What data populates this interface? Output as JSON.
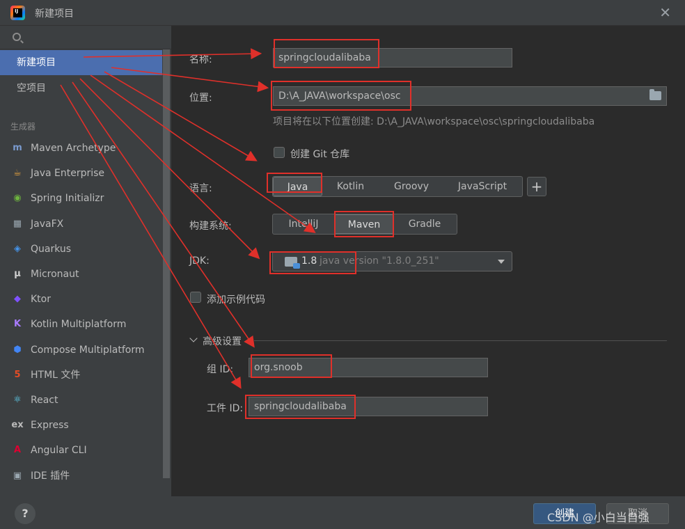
{
  "window": {
    "title": "新建项目",
    "logo_text": "IJ"
  },
  "sidebar": {
    "items": [
      {
        "label": "新建项目"
      },
      {
        "label": "空项目"
      }
    ],
    "section_title": "生成器",
    "generators": [
      {
        "label": "Maven Archetype",
        "icon": "maven-icon",
        "glyph": "m",
        "color": "#7a9bcf"
      },
      {
        "label": "Java Enterprise",
        "icon": "java-enterprise-icon",
        "glyph": "☕",
        "color": "#e7a33e"
      },
      {
        "label": "Spring Initializr",
        "icon": "spring-icon",
        "glyph": "◉",
        "color": "#6db33f"
      },
      {
        "label": "JavaFX",
        "icon": "javafx-icon",
        "glyph": "▦",
        "color": "#9aa7b0"
      },
      {
        "label": "Quarkus",
        "icon": "quarkus-icon",
        "glyph": "◈",
        "color": "#4695eb"
      },
      {
        "label": "Micronaut",
        "icon": "micronaut-icon",
        "glyph": "μ",
        "color": "#cfcfcf"
      },
      {
        "label": "Ktor",
        "icon": "ktor-icon",
        "glyph": "◆",
        "color": "#7f52ff"
      },
      {
        "label": "Kotlin Multiplatform",
        "icon": "kotlin-icon",
        "glyph": "K",
        "color": "#a97bff"
      },
      {
        "label": "Compose Multiplatform",
        "icon": "compose-icon",
        "glyph": "⬢",
        "color": "#4285f4"
      },
      {
        "label": "HTML 文件",
        "icon": "html5-icon",
        "glyph": "5",
        "color": "#e44d26"
      },
      {
        "label": "React",
        "icon": "react-icon",
        "glyph": "⚛",
        "color": "#61dafb"
      },
      {
        "label": "Express",
        "icon": "express-icon",
        "glyph": "ex",
        "color": "#bbbbbb"
      },
      {
        "label": "Angular CLI",
        "icon": "angular-icon",
        "glyph": "A",
        "color": "#dd0031"
      },
      {
        "label": "IDE 插件",
        "icon": "ide-plugin-icon",
        "glyph": "▣",
        "color": "#9aa7b0"
      }
    ]
  },
  "form": {
    "name_label": "名称:",
    "name_value": "springcloudalibaba",
    "location_label": "位置:",
    "location_value": "D:\\A_JAVA\\workspace\\osc",
    "location_hint": "项目将在以下位置创建: D:\\A_JAVA\\workspace\\osc\\springcloudalibaba",
    "git_label": "创建 Git 仓库",
    "language_label": "语言:",
    "languages": [
      "Java",
      "Kotlin",
      "Groovy",
      "JavaScript"
    ],
    "language_selected": "Java",
    "add_label": "+",
    "build_label": "构建系统:",
    "build_systems": [
      "IntelliJ",
      "Maven",
      "Gradle"
    ],
    "build_selected": "Maven",
    "jdk_label": "JDK:",
    "jdk_version": "1.8",
    "jdk_desc": "java version \"1.8.0_251\"",
    "sample_label": "添加示例代码",
    "advanced_label": "高级设置",
    "group_label": "组 ID:",
    "group_value": "org.snoob",
    "artifact_label": "工件 ID:",
    "artifact_value": "springcloudalibaba"
  },
  "footer": {
    "help_label": "?",
    "create_label": "创建",
    "cancel_label": "取消",
    "watermark": "CSDN @小白当自强"
  },
  "colors": {
    "accent": "#4b6eaf",
    "annotation": "#e0302a",
    "background": "#2b2b2b",
    "panel": "#3c3f41"
  }
}
